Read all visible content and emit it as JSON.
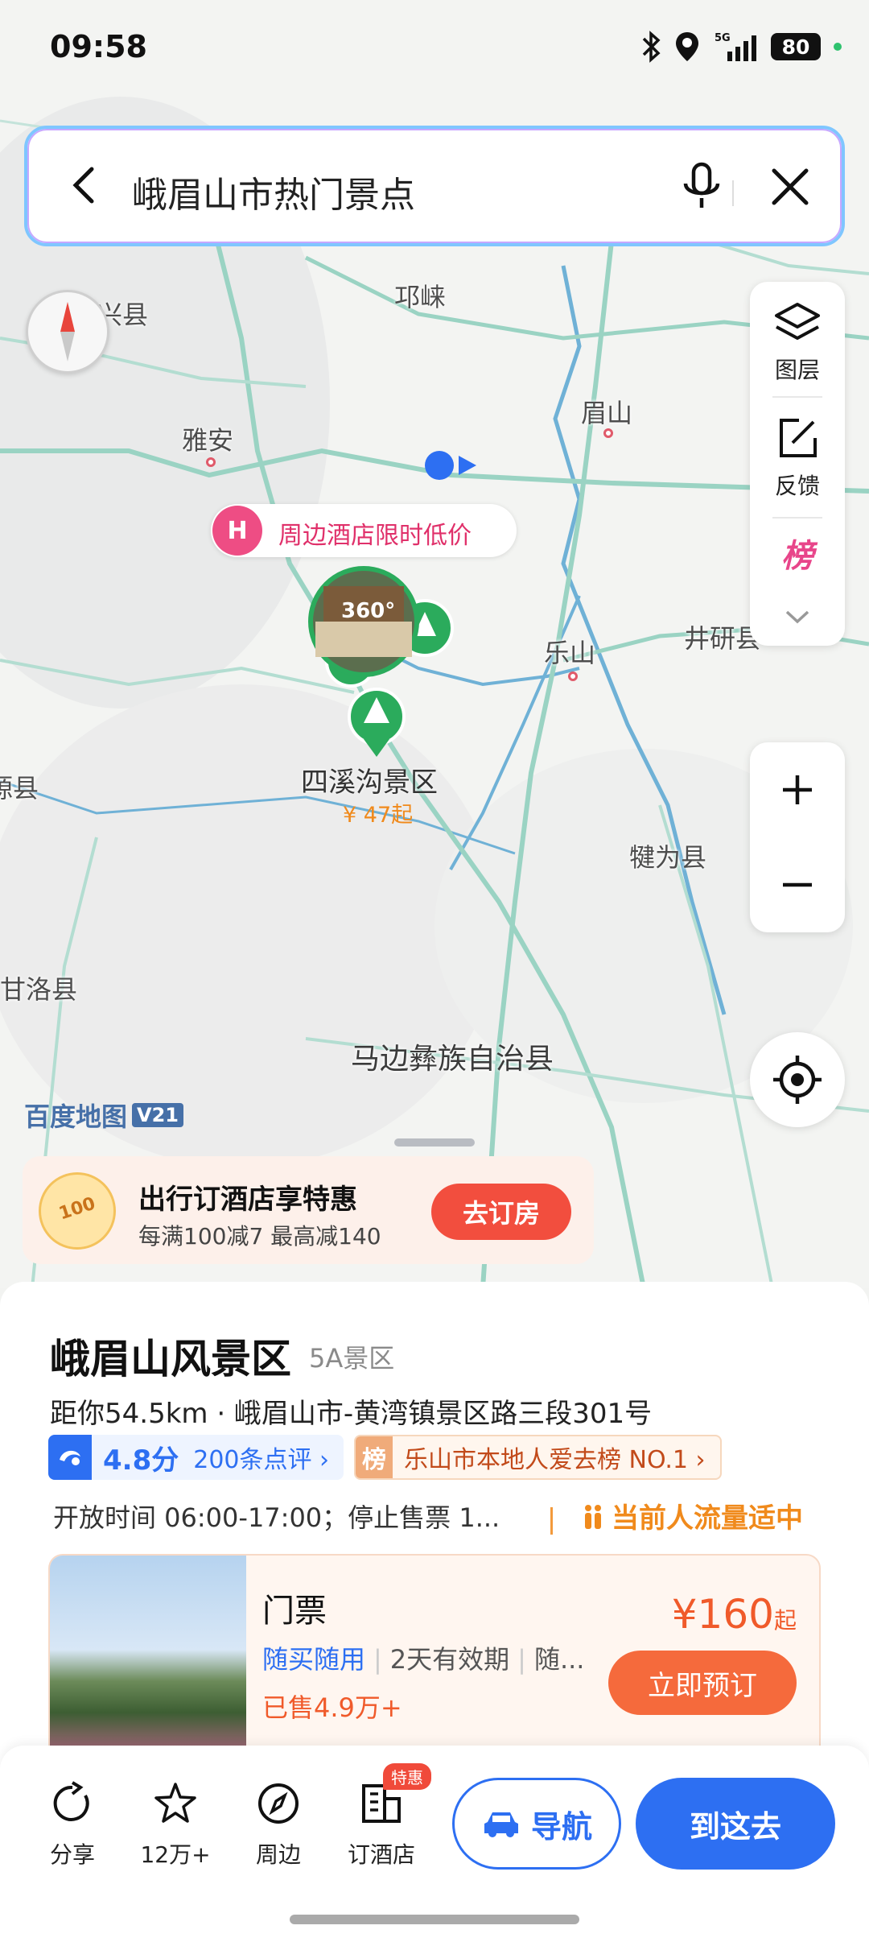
{
  "status_bar": {
    "time": "09:58",
    "battery": "80",
    "network": "5G"
  },
  "search": {
    "query": "峨眉山市热门景点"
  },
  "map": {
    "labels": {
      "baoxing": "宝兴县",
      "qionglai": "邛崃",
      "yaan": "雅安",
      "meishan": "眉山",
      "leshan": "乐山",
      "jingyan": "井研县",
      "qianwei": "犍为县",
      "left_county": "源县",
      "ganluo": "甘洛县",
      "mabian": "马边彝族自治县"
    },
    "poi": {
      "name": "四溪沟景区",
      "price": "¥ 47起",
      "panorama": "360°"
    },
    "hotel_pill": "周边酒店限时低价",
    "brand": "百度地图",
    "brand_version": "V21"
  },
  "tools": {
    "layers": "图层",
    "feedback": "反馈",
    "rank": "榜"
  },
  "promo": {
    "title": "出行订酒店享特惠",
    "subtitle": "每满100减7  最高减140",
    "button": "去订房",
    "coin": "100"
  },
  "place": {
    "name": "峨眉山风景区",
    "grade": "5A景区",
    "address": "距你54.5km · 峨眉山市-黄湾镇景区路三段301号",
    "rating": "4.8分",
    "reviews": "200条点评 ›",
    "rank_badge": "榜",
    "rank": "乐山市本地人爱去榜 NO.1 ›",
    "hours": "开放时间 06:00-17:00；停止售票 1...",
    "crowd": "当前人流量适中"
  },
  "ticket": {
    "name": "门票",
    "tag1": "随买随用",
    "tag2": "2天有效期",
    "tag3": "随...",
    "sold": "已售4.9万+",
    "price": "¥160",
    "price_suffix": "起",
    "book": "立即预订"
  },
  "actions": {
    "share": "分享",
    "favorite": "12万+",
    "nearby": "周边",
    "hotel": "订酒店",
    "hotel_badge": "特惠",
    "navigate": "导航",
    "go": "到这去"
  },
  "colors": {
    "accent": "#2d6ff2",
    "orange": "#f05a2a",
    "green_poi": "#2bab5c",
    "pink": "#ee4d84"
  }
}
